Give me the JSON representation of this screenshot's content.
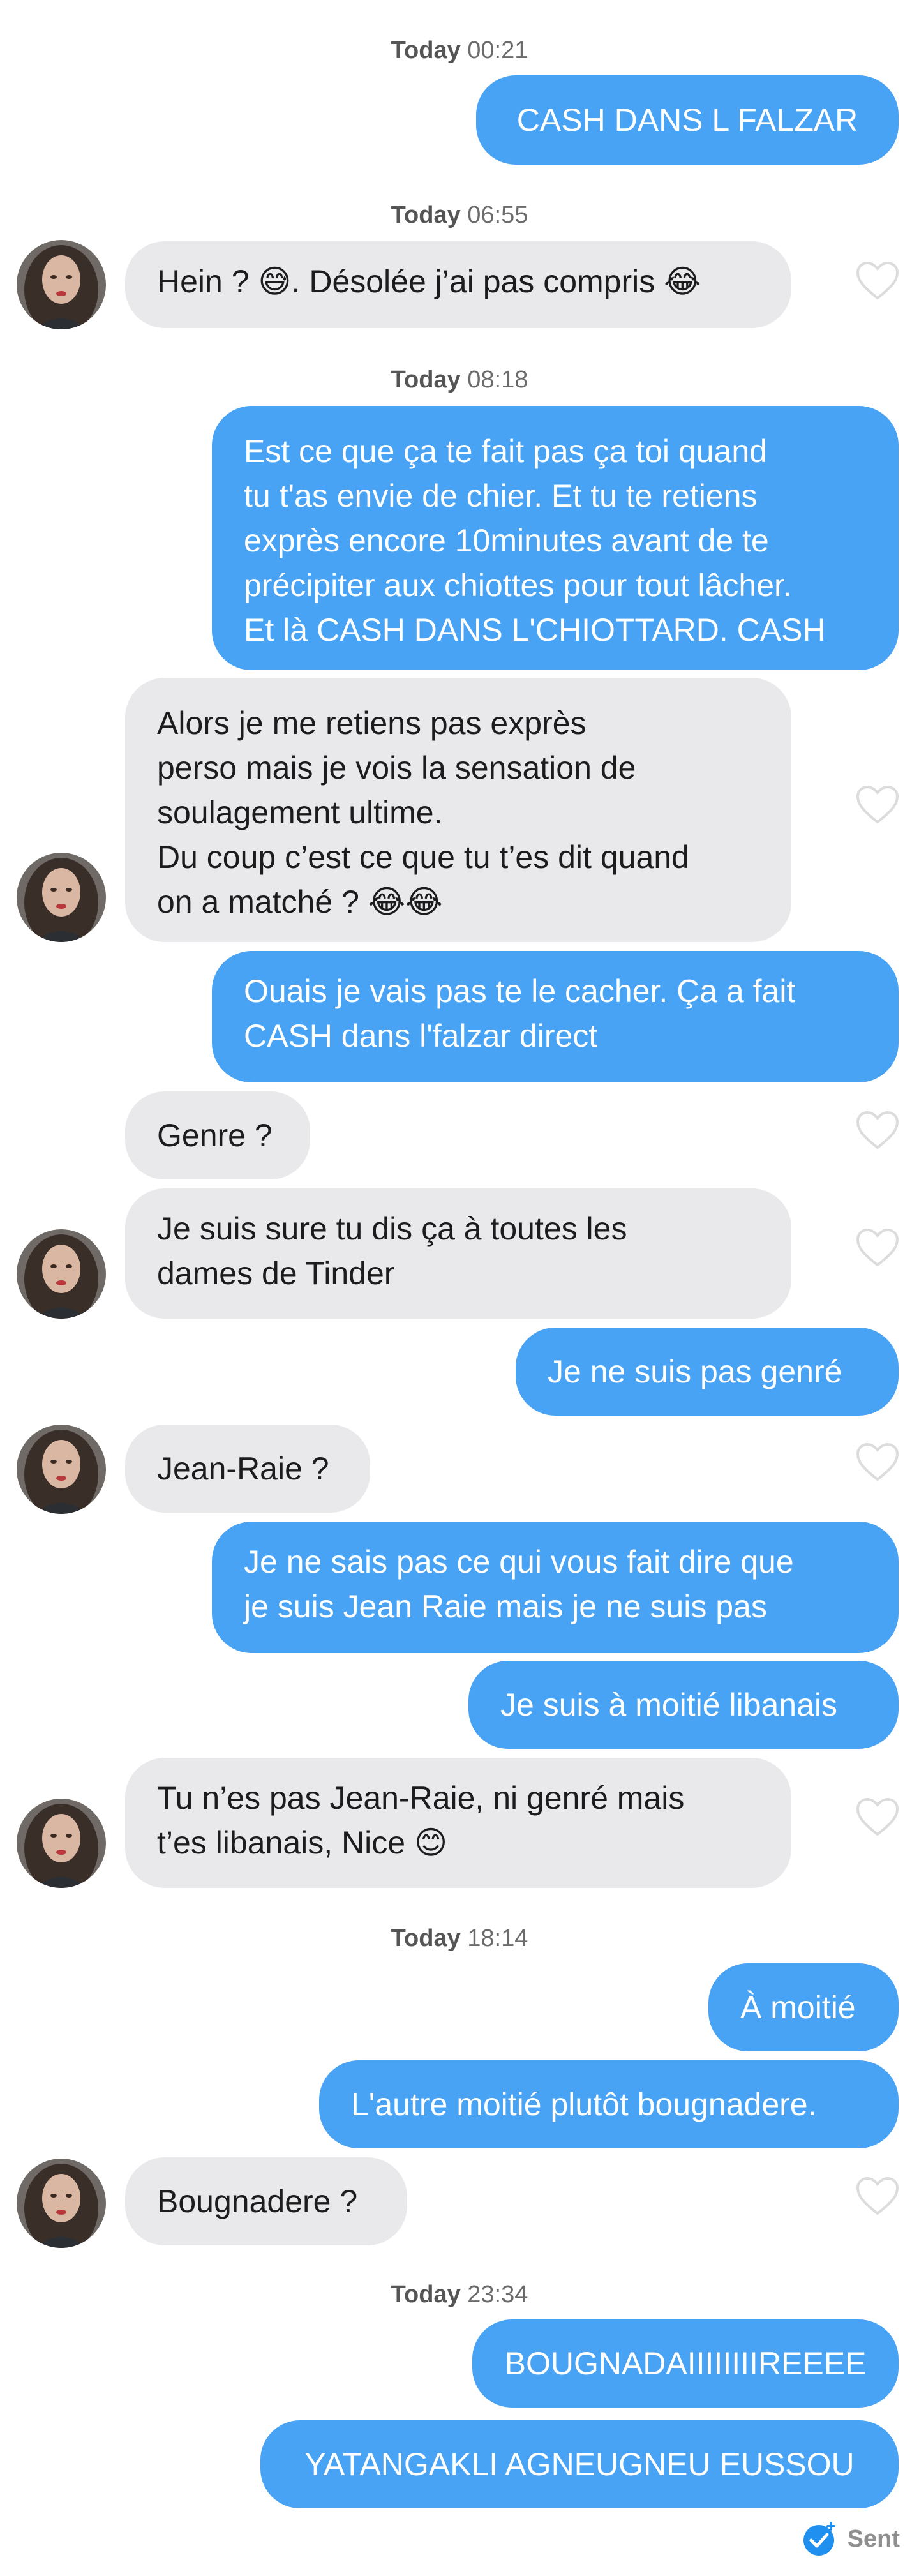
{
  "conversation": {
    "timestamps": [
      {
        "day": "Today",
        "time": "00:21"
      },
      {
        "day": "Today",
        "time": "06:55"
      },
      {
        "day": "Today",
        "time": "08:18"
      },
      {
        "day": "Today",
        "time": "18:14"
      },
      {
        "day": "Today",
        "time": "23:34"
      }
    ],
    "messages": [
      {
        "sender": "me",
        "text": "CASH DANS L FALZAR"
      },
      {
        "sender": "match",
        "text": "Hein ? 😅. Désolée j’ai pas compris 😂"
      },
      {
        "sender": "me",
        "text": "Est ce que ça te fait pas ça toi quand\ntu t'as envie de chier. Et tu te retiens\nexprès encore 10minutes avant de te\nprécipiter aux chiottes pour tout lâcher.\nEt là CASH DANS L'CHIOTTARD. CASH"
      },
      {
        "sender": "match",
        "text": "Alors je me retiens pas exprès\nperso mais je vois la sensation de\nsoulagement ultime.\nDu coup c’est ce que tu t’es dit quand\non a matché ? 😂😂"
      },
      {
        "sender": "me",
        "text": "Ouais je vais pas te le cacher. Ça a fait\nCASH dans l'falzar direct"
      },
      {
        "sender": "match",
        "text": "Genre ?"
      },
      {
        "sender": "match",
        "text": "Je suis sure tu dis ça à toutes les\ndames de Tinder"
      },
      {
        "sender": "me",
        "text": "Je ne suis pas genré"
      },
      {
        "sender": "match",
        "text": "Jean-Raie ?"
      },
      {
        "sender": "me",
        "text": "Je ne sais pas ce qui vous fait dire que\nje suis Jean Raie mais je ne suis pas"
      },
      {
        "sender": "me",
        "text": "Je suis à moitié libanais"
      },
      {
        "sender": "match",
        "text": "Tu n’es pas Jean-Raie, ni genré mais\nt’es libanais, Nice 😊"
      },
      {
        "sender": "me",
        "text": "À moitié"
      },
      {
        "sender": "me",
        "text": "L'autre moitié plutôt bougnadere."
      },
      {
        "sender": "match",
        "text": "Bougnadere ?"
      },
      {
        "sender": "me",
        "text": "BOUGNADAIIIIIIIIREEEE"
      },
      {
        "sender": "me",
        "text": "YATANGAKLI AGNEUGNEU EUSSOU"
      }
    ],
    "status": {
      "label": "Sent"
    }
  },
  "colors": {
    "outgoing_bubble": "#48a3f5",
    "incoming_bubble": "#e9e9ec",
    "timestamp_text": "#6b6b6b",
    "heart_outline": "#dcdcdc",
    "sent_check": "#1f8ff0"
  },
  "icons": {
    "like": "heart-outline-icon",
    "sent": "double-check-icon",
    "avatar": "user-photo"
  }
}
